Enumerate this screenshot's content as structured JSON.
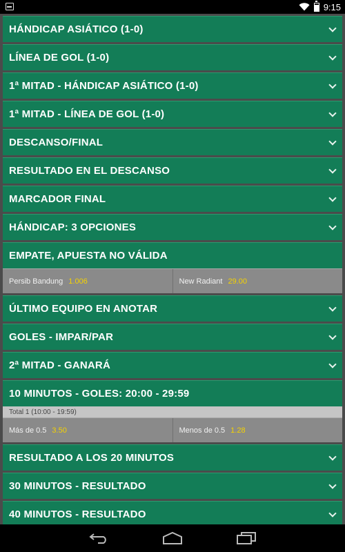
{
  "status": {
    "time": "9:15"
  },
  "markets": {
    "m0": "HÁNDICAP ASIÁTICO (1-0)",
    "m1": "LÍNEA DE GOL (1-0)",
    "m2": "1ª MITAD - HÁNDICAP ASIÁTICO (1-0)",
    "m3": "1ª MITAD - LÍNEA DE GOL (1-0)",
    "m4": "DESCANSO/FINAL",
    "m5": "RESULTADO EN EL DESCANSO",
    "m6": "MARCADOR FINAL",
    "m7": "HÁNDICAP: 3 OPCIONES",
    "m8": {
      "label": "EMPATE, APUESTA NO VÁLIDA",
      "left": {
        "name": "Persib Bandung",
        "price": "1.006"
      },
      "right": {
        "name": "New Radiant",
        "price": "29.00"
      }
    },
    "m9": "ÚLTIMO EQUIPO EN ANOTAR",
    "m10": "GOLES - IMPAR/PAR",
    "m11": "2ª MITAD - GANARÁ",
    "m12": {
      "label": "10 MINUTOS - GOLES: 20:00 - 29:59",
      "sublabel": "Total 1 (10:00 - 19:59)",
      "left": {
        "name": "Más de 0.5",
        "price": "3.50"
      },
      "right": {
        "name": "Menos de 0.5",
        "price": "1.28"
      }
    },
    "m13": "RESULTADO A LOS 20 MINUTOS",
    "m14": "30 MINUTOS - RESULTADO",
    "m15": "40 MINUTOS - RESULTADO"
  },
  "icons": {
    "expand": "chevron-down-icon",
    "back": "back-icon",
    "home": "home-icon",
    "recents": "recents-icon",
    "wifi": "wifi-icon",
    "battery": "battery-icon",
    "notification": "notification-icon"
  },
  "colors": {
    "market_header": "#137d57",
    "odds_row": "#8a8a8a",
    "price": "#f5d200",
    "background": "#4b4b4b"
  }
}
